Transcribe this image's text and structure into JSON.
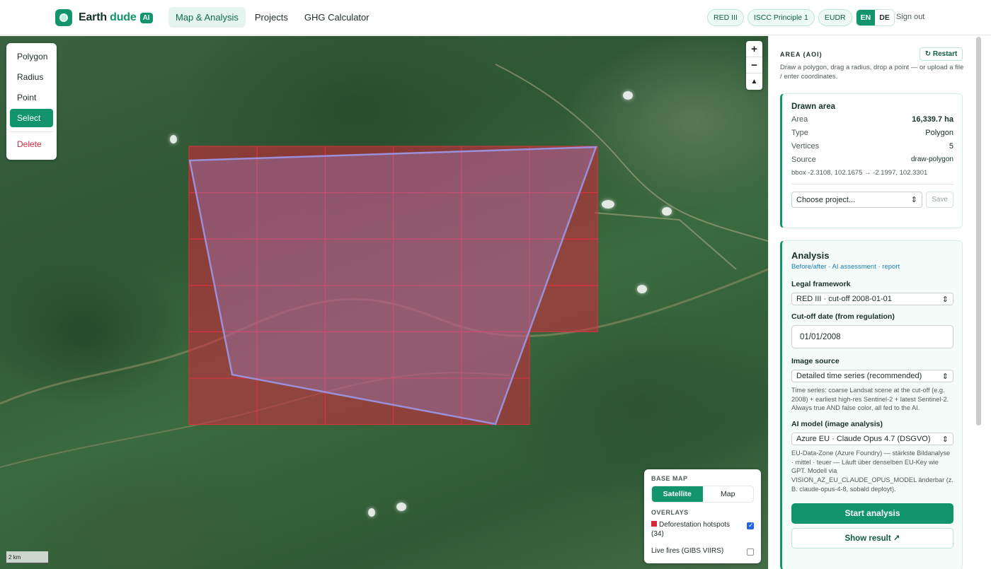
{
  "header": {
    "logo_word1": "Earth",
    "logo_word2": "dude",
    "logo_badge": "AI",
    "nav": [
      "Map & Analysis",
      "Projects",
      "GHG Calculator"
    ],
    "nav_active": "Map & Analysis",
    "chips": [
      "RED III",
      "ISCC Principle 1",
      "EUDR"
    ],
    "lang_en": "EN",
    "lang_de": "DE",
    "sign_out": "Sign out"
  },
  "map": {
    "draw_tools": {
      "polygon": "Polygon",
      "radius": "Radius",
      "point": "Point",
      "select": "Select",
      "delete": "Delete"
    },
    "active_tool": "Select",
    "zoom_in": "+",
    "zoom_out": "−",
    "compass": "▲",
    "scale_label": "2 km",
    "layers": {
      "base_map_label": "BASE MAP",
      "base_satellite": "Satellite",
      "base_map": "Map",
      "overlays_label": "OVERLAYS",
      "deforestation": "Deforestation hotspots (34)",
      "deforestation_checked": true,
      "fires": "Live fires (GIBS VIIRS)",
      "fires_checked": false,
      "hotspot_color": "#d7263d"
    }
  },
  "panel": {
    "aoi_title": "AREA (AOI)",
    "restart": "↻ Restart",
    "aoi_hint": "Draw a polygon, drag a radius, drop a point — or upload a file / enter coordinates.",
    "drawn_area": {
      "title": "Drawn area",
      "area_label": "Area",
      "area_value": "16,339.7 ha",
      "type_label": "Type",
      "type_value": "Polygon",
      "vertices_label": "Vertices",
      "vertices_value": "5",
      "source_label": "Source",
      "source_value": "draw-polygon",
      "bbox": "bbox -2.3108, 102.1675 → -2.1997, 102.3301",
      "project_select": "Choose project...",
      "save": "Save"
    },
    "analysis": {
      "title": "Analysis",
      "subtitle": "Before/after · AI assessment · report",
      "legal_label": "Legal framework",
      "legal_value": "RED III · cut-off 2008-01-01",
      "cutoff_label": "Cut-off date (from regulation)",
      "cutoff_value": "01/01/2008",
      "source_label": "Image source",
      "source_value": "Detailed time series (recommended)",
      "source_help": "Time series: coarse Landsat scene at the cut-off (e.g. 2008) + earliest high-res Sentinel-2 + latest Sentinel-2. Always true AND false color, all fed to the AI.",
      "model_label": "AI model (image analysis)",
      "model_value": "Azure EU · Claude Opus 4.7 (DSGVO)",
      "model_help": "EU-Data-Zone (Azure Foundry) — stärkste Bildanalyse · mittel · teuer — Läuft über denselben EU-Key wie GPT. Modell via VISION_AZ_EU_CLAUDE_OPUS_MODEL änderbar (z. B. claude-opus-4-8, sobald deployt).",
      "start_button": "Start analysis",
      "show_button": "Show result ↗"
    }
  },
  "colors": {
    "accent": "#12946c",
    "hotspot": "#d7263d",
    "polygon": "#9a8fd8"
  }
}
